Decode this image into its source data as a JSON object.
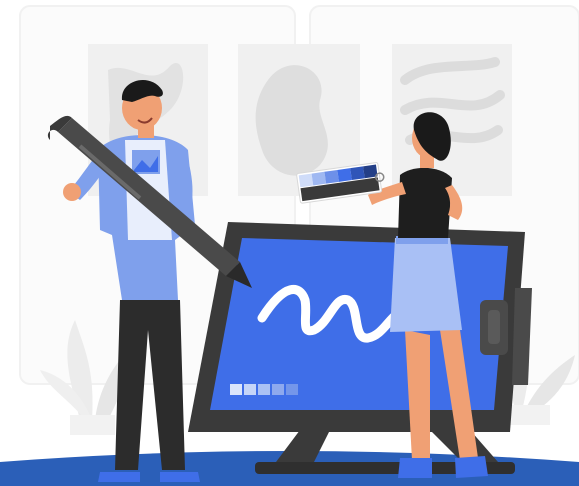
{
  "scene": {
    "subject": "designers-with-pen-tablet",
    "palette": {
      "accent_blue": "#3f6ee8",
      "dark_gray": "#3a3a3a",
      "light_blue": "#a9c0f5",
      "skin": "#f0a074",
      "hair": "#1a1a1a",
      "background_panel": "#f5f5f5"
    },
    "swatch_colors": [
      "#cfdcf9",
      "#9fb8f2",
      "#6d90e9",
      "#3f6ee8",
      "#2f55b8",
      "#233f87"
    ],
    "icons": [
      "stylus-icon",
      "color-swatch-icon",
      "drawing-tablet-icon",
      "squiggle-icon",
      "plant-icon"
    ]
  }
}
